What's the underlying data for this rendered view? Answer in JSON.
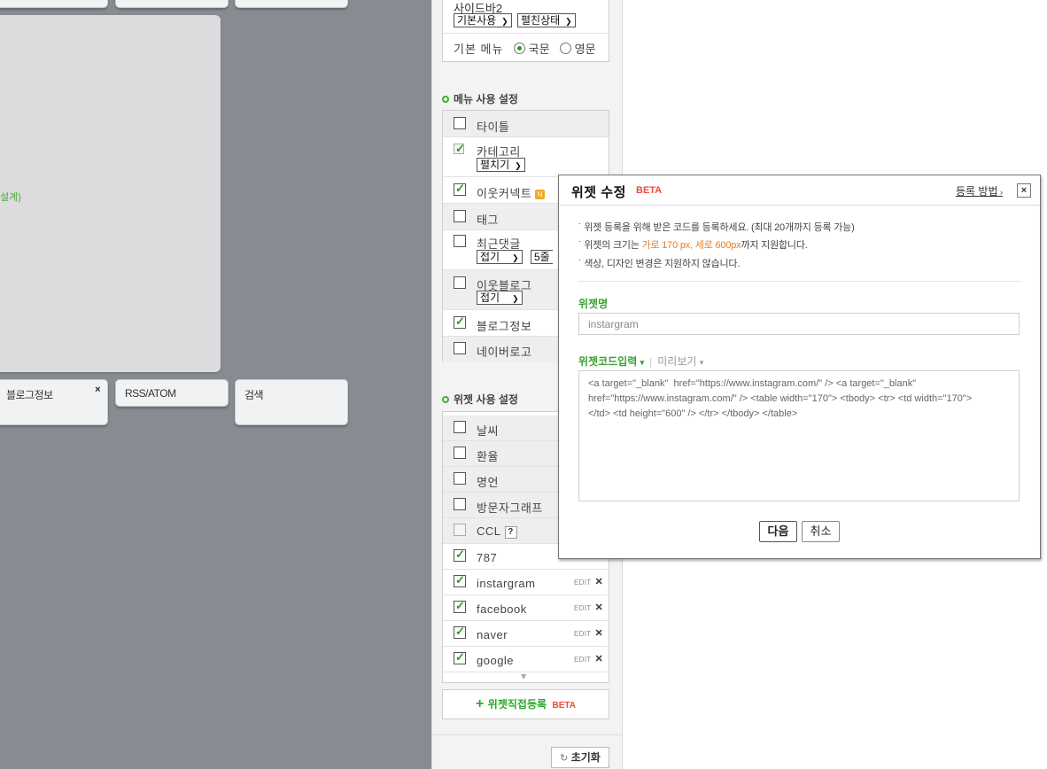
{
  "canvas": {
    "tiles_top": [
      "",
      "",
      ""
    ],
    "green_fragment": "설계)",
    "tiles": [
      {
        "label": "블로그정보",
        "close": "×"
      },
      {
        "label": "RSS/ATOM"
      },
      {
        "label": "검색"
      }
    ]
  },
  "sidebar": {
    "sidebar2_label": "사이드바2",
    "sidebar2_select1": "기본사용",
    "sidebar2_select2": "펼친상태",
    "basic_menu_label": "기본 메뉴",
    "lang_ko": "국문",
    "lang_en": "영문",
    "lang_selected": "국문"
  },
  "menu_section": {
    "title": "메뉴 사용 설정",
    "items": [
      {
        "label": "타이틀",
        "checked": false
      },
      {
        "label": "카테고리",
        "checked": true,
        "select": "펼치기",
        "disabled": true
      },
      {
        "label": "이웃커넥트",
        "checked": true,
        "badge": "N"
      },
      {
        "label": "태그",
        "checked": false
      },
      {
        "label": "최근댓글",
        "checked": false,
        "select": "접기",
        "select2": "5줄"
      },
      {
        "label": "이웃블로그",
        "checked": false,
        "select": "접기"
      },
      {
        "label": "블로그정보",
        "checked": true
      },
      {
        "label": "네이버로고",
        "checked": false
      }
    ]
  },
  "widget_section": {
    "title": "위젯 사용 설정",
    "items": [
      {
        "label": "날씨",
        "checked": false
      },
      {
        "label": "환율",
        "checked": false
      },
      {
        "label": "명언",
        "checked": false
      },
      {
        "label": "방문자그래프",
        "checked": false
      },
      {
        "label": "CCL",
        "checked": false,
        "badge": "?"
      },
      {
        "label": "787",
        "checked": true
      },
      {
        "label": "instargram",
        "checked": true,
        "edit": "EDIT"
      },
      {
        "label": "facebook",
        "checked": true,
        "edit": "EDIT"
      },
      {
        "label": "naver",
        "checked": true,
        "edit": "EDIT"
      },
      {
        "label": "google",
        "checked": true,
        "edit": "EDIT"
      }
    ],
    "scroll_indicator": "▼"
  },
  "register_button": {
    "plus": "+",
    "label": "위젯직접등록",
    "beta": "BETA"
  },
  "reset_button": "초기화",
  "dialog": {
    "title": "위젯 수정",
    "beta": "BETA",
    "help_link": "등록 방법",
    "close": "×",
    "notes": [
      "위젯 등록을 위해 받은 코드를 등록하세요. (최대 20개까지 등록 가능)",
      "색상, 디자인 변경은 지원하지 않습니다."
    ],
    "size_note_prefix": "위젯의 크기는 ",
    "size_note_highlight": "가로 170 px, 세로 600px",
    "size_note_suffix": "까지 지원합니다.",
    "name_label": "위젯명",
    "name_value": "instargram",
    "code_tab": "위젯코드입력",
    "preview_tab": "미리보기",
    "code_value": "<a target=\"_blank\"  href=\"https://www.instagram.com/\" /> <a target=\"_blank\" href=\"https://www.instagram.com/\" /> <table width=\"170\"> <tbody> <tr> <td width=\"170\">\n</td> <td height=\"600\" /> </tr> </tbody> </table>",
    "next_button": "다음",
    "cancel_button": "취소"
  }
}
